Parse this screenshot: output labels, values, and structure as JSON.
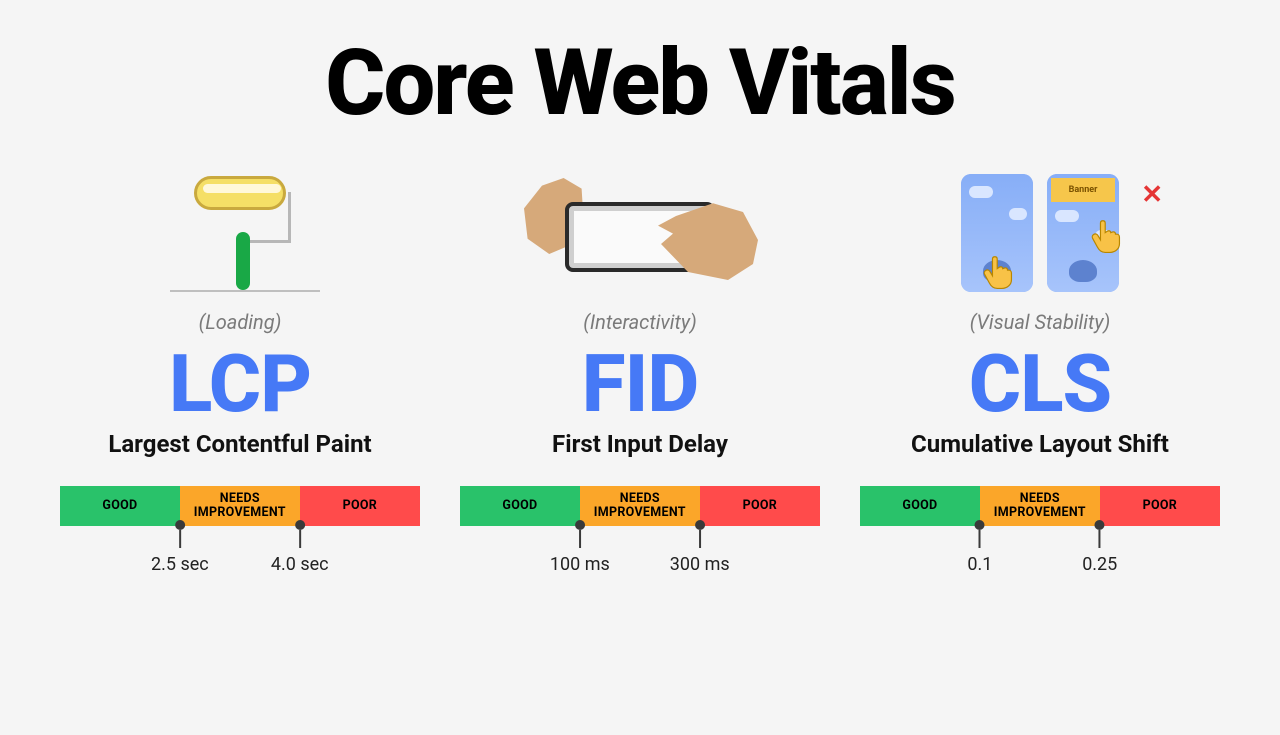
{
  "title": "Core Web Vitals",
  "scale_labels": {
    "good": "GOOD",
    "mid": "NEEDS\nIMPROVEMENT",
    "poor": "POOR"
  },
  "metrics": [
    {
      "category": "(Loading)",
      "acronym": "LCP",
      "full_name": "Largest Contentful Paint",
      "threshold_good": "2.5 sec",
      "threshold_poor": "4.0 sec"
    },
    {
      "category": "(Interactivity)",
      "acronym": "FID",
      "full_name": "First Input Delay",
      "threshold_good": "100 ms",
      "threshold_poor": "300 ms"
    },
    {
      "category": "(Visual Stability)",
      "acronym": "CLS",
      "full_name": "Cumulative Layout Shift",
      "threshold_good": "0.1",
      "threshold_poor": "0.25",
      "banner_label": "Banner"
    }
  ]
}
